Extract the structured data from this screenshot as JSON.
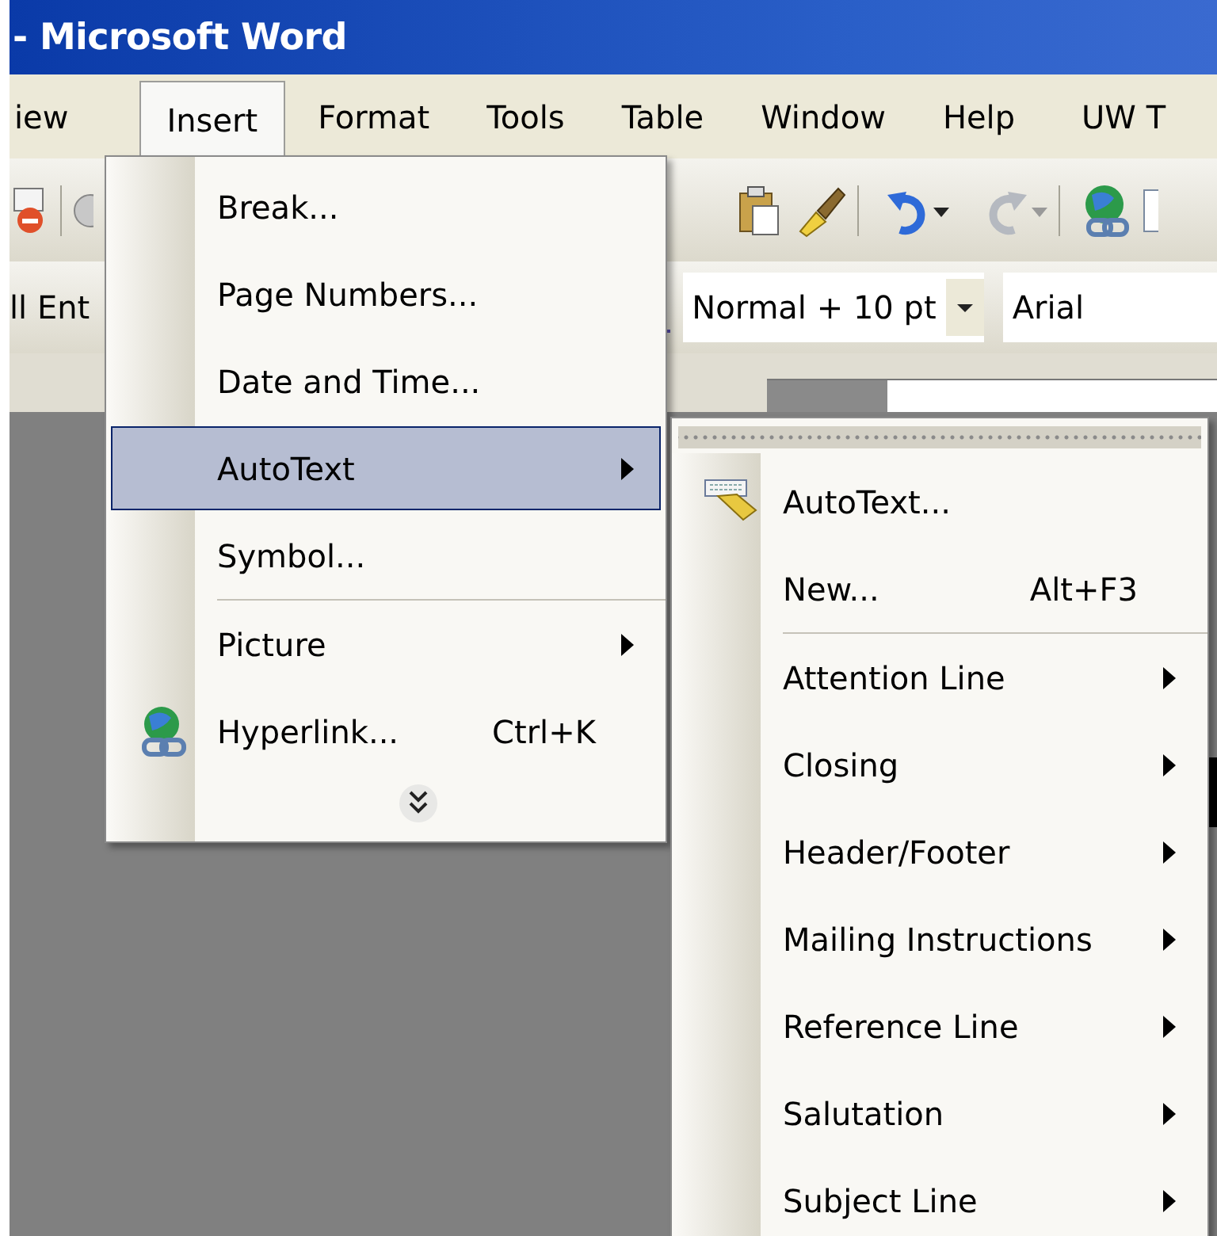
{
  "window": {
    "title": "- Microsoft Word"
  },
  "menu_bar": [
    {
      "label": "iew",
      "selected": false
    },
    {
      "label": "Insert",
      "selected": true
    },
    {
      "label": "Format",
      "selected": false
    },
    {
      "label": "Tools",
      "selected": false
    },
    {
      "label": "Table",
      "selected": false
    },
    {
      "label": "Window",
      "selected": false
    },
    {
      "label": "Help",
      "selected": false
    },
    {
      "label": "UW T",
      "selected": false
    }
  ],
  "formatting_bar": {
    "partial_label": "ll Ent",
    "style": "Normal + 10 pt",
    "font": "Arial"
  },
  "insert_menu": [
    {
      "kind": "item",
      "label": "Break...",
      "selected": false
    },
    {
      "kind": "item",
      "label": "Page Numbers...",
      "selected": false
    },
    {
      "kind": "item",
      "label": "Date and Time...",
      "selected": false
    },
    {
      "kind": "item",
      "label": "AutoText",
      "submenu": true,
      "selected": true
    },
    {
      "kind": "item",
      "label": "Symbol...",
      "selected": false
    },
    {
      "kind": "separator"
    },
    {
      "kind": "item",
      "label": "Picture",
      "submenu": true,
      "selected": false
    },
    {
      "kind": "item",
      "label": "Hyperlink...",
      "shortcut": "Ctrl+K",
      "selected": false
    },
    {
      "kind": "more"
    }
  ],
  "autotext_menu": [
    {
      "kind": "item",
      "label": "AutoText...",
      "selected": false
    },
    {
      "kind": "item",
      "label": "New...",
      "shortcut": "Alt+F3",
      "selected": false
    },
    {
      "kind": "separator"
    },
    {
      "kind": "item",
      "label": "Attention Line",
      "submenu": true,
      "selected": false
    },
    {
      "kind": "item",
      "label": "Closing",
      "submenu": true,
      "selected": false
    },
    {
      "kind": "item",
      "label": "Header/Footer",
      "submenu": true,
      "selected": false
    },
    {
      "kind": "item",
      "label": "Mailing Instructions",
      "submenu": true,
      "selected": false
    },
    {
      "kind": "item",
      "label": "Reference Line",
      "submenu": true,
      "selected": false
    },
    {
      "kind": "item",
      "label": "Salutation",
      "submenu": true,
      "selected": false
    },
    {
      "kind": "item",
      "label": "Subject Line",
      "submenu": true,
      "selected": false
    }
  ]
}
